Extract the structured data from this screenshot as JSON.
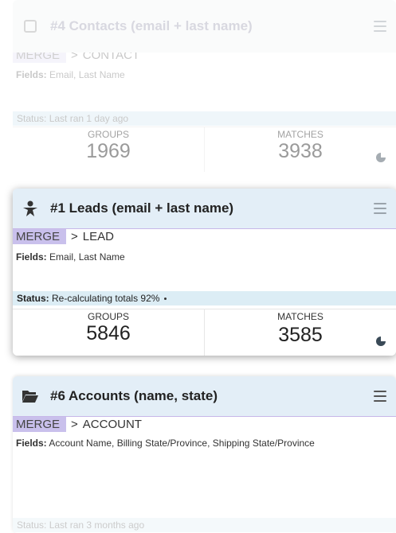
{
  "cards": [
    {
      "title": "#4 Contacts (email + last name)",
      "icon": "square-outline-icon",
      "merge_label": "MERGE",
      "target_arrow": ">",
      "target": "CONTACT",
      "fields_label": "Fields:",
      "fields_value": "Email, Last Name",
      "status_label": "Status:",
      "status_value": "Last ran 1 day ago",
      "groups_label": "GROUPS",
      "groups_value": "1969",
      "matches_label": "MATCHES",
      "matches_value": "3938"
    },
    {
      "title": "#1 Leads (email + last name)",
      "icon": "person-icon",
      "merge_label": "MERGE",
      "target_arrow": ">",
      "target": "LEAD",
      "fields_label": "Fields:",
      "fields_value": "Email, Last Name",
      "status_label": "Status:",
      "status_value": "Re-calculating totals 92%",
      "groups_label": "GROUPS",
      "groups_value": "5846",
      "matches_label": "MATCHES",
      "matches_value": "3585"
    },
    {
      "title": "#6 Accounts (name, state)",
      "icon": "folder-open-icon",
      "merge_label": "MERGE",
      "target_arrow": ">",
      "target": "ACCOUNT",
      "fields_label": "Fields:",
      "fields_value": "Account Name, Billing State/Province, Shipping State/Province",
      "status_label": "Status:",
      "status_value": "Last ran 3 months ago"
    }
  ],
  "colors": {
    "header_bg": "#e3eef7",
    "merge_chip": "#c9c0ec",
    "status_bg": "#dcedf5"
  }
}
